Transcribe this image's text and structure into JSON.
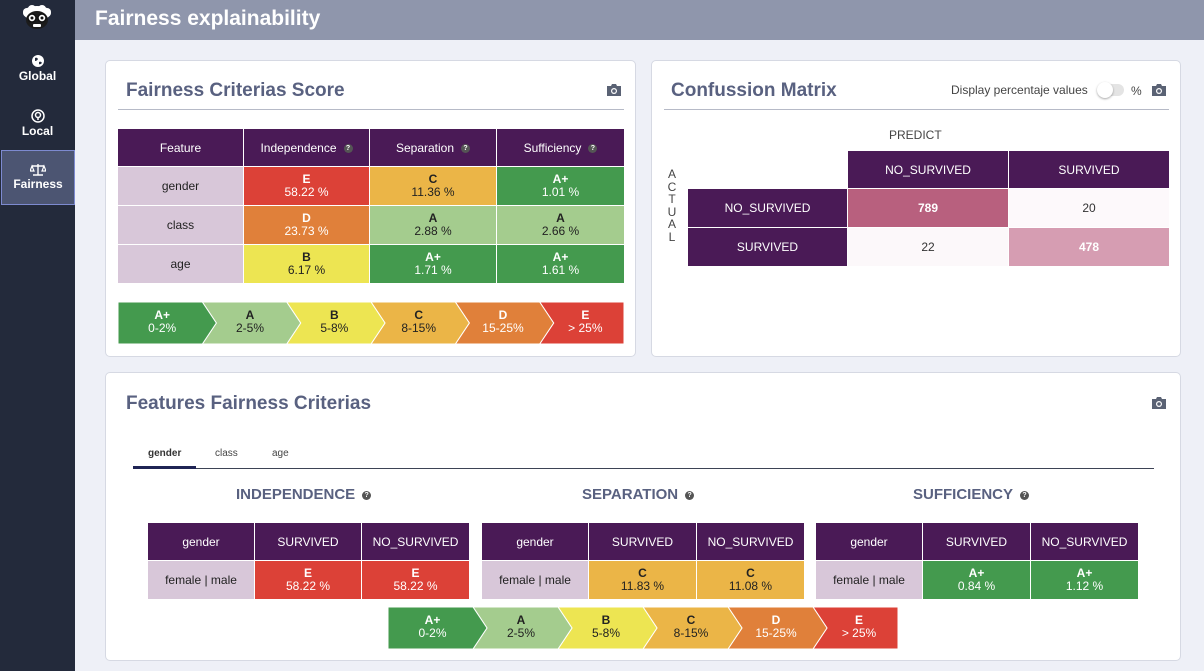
{
  "page": {
    "title": "Fairness explainability"
  },
  "sidebar": {
    "items": [
      {
        "label": "Global",
        "icon": "globe-icon"
      },
      {
        "label": "Local",
        "icon": "location-pin-icon"
      },
      {
        "label": "Fairness",
        "icon": "balance-scale-icon",
        "active": true
      }
    ]
  },
  "fairness_score": {
    "title": "Fairness Criterias Score",
    "headers": [
      "Feature",
      "Independence",
      "Separation",
      "Sufficiency"
    ],
    "rows": [
      {
        "feature": "gender",
        "cells": [
          {
            "grade": "E",
            "pct": "58.22 %"
          },
          {
            "grade": "C",
            "pct": "11.36 %"
          },
          {
            "grade": "A+",
            "pct": "1.01 %"
          }
        ]
      },
      {
        "feature": "class",
        "cells": [
          {
            "grade": "D",
            "pct": "23.73 %"
          },
          {
            "grade": "A",
            "pct": "2.88 %"
          },
          {
            "grade": "A",
            "pct": "2.66 %"
          }
        ]
      },
      {
        "feature": "age",
        "cells": [
          {
            "grade": "B",
            "pct": "6.17 %"
          },
          {
            "grade": "A+",
            "pct": "1.71 %"
          },
          {
            "grade": "A+",
            "pct": "1.61 %"
          }
        ]
      }
    ]
  },
  "legend": [
    {
      "grade": "A+",
      "range": "0-2%"
    },
    {
      "grade": "A",
      "range": "2-5%"
    },
    {
      "grade": "B",
      "range": "5-8%"
    },
    {
      "grade": "C",
      "range": "8-15%"
    },
    {
      "grade": "D",
      "range": "15-25%"
    },
    {
      "grade": "E",
      "range": "> 25%"
    }
  ],
  "grade_colors": {
    "A+": "#449a4e",
    "A": "#a4cc8e",
    "B": "#ede552",
    "C": "#ebb547",
    "D": "#e0803a",
    "E": "#dc4137"
  },
  "confusion": {
    "title": "Confussion Matrix",
    "toggle_label": "Display percentaje values",
    "toggle_unit": "%",
    "predict_label": "PREDICT",
    "actual_label": "ACTUAL",
    "columns": [
      "NO_SURVIVED",
      "SURVIVED"
    ],
    "rows": [
      {
        "label": "NO_SURVIVED",
        "values": [
          "789",
          "20"
        ]
      },
      {
        "label": "SURVIVED",
        "values": [
          "22",
          "478"
        ]
      }
    ]
  },
  "features": {
    "title": "Features Fairness Criterias",
    "tabs": [
      "gender",
      "class",
      "age"
    ],
    "active_tab": "gender",
    "criteria": [
      {
        "title": "INDEPENDENCE",
        "headers": [
          "gender",
          "SURVIVED",
          "NO_SURVIVED"
        ],
        "row_label": "female | male",
        "cells": [
          {
            "grade": "E",
            "pct": "58.22 %"
          },
          {
            "grade": "E",
            "pct": "58.22 %"
          }
        ]
      },
      {
        "title": "SEPARATION",
        "headers": [
          "gender",
          "SURVIVED",
          "NO_SURVIVED"
        ],
        "row_label": "female | male",
        "cells": [
          {
            "grade": "C",
            "pct": "11.83 %"
          },
          {
            "grade": "C",
            "pct": "11.08 %"
          }
        ]
      },
      {
        "title": "SUFFICIENCY",
        "headers": [
          "gender",
          "SURVIVED",
          "NO_SURVIVED"
        ],
        "row_label": "female | male",
        "cells": [
          {
            "grade": "A+",
            "pct": "0.84 %"
          },
          {
            "grade": "A+",
            "pct": "1.12 %"
          }
        ]
      }
    ]
  }
}
